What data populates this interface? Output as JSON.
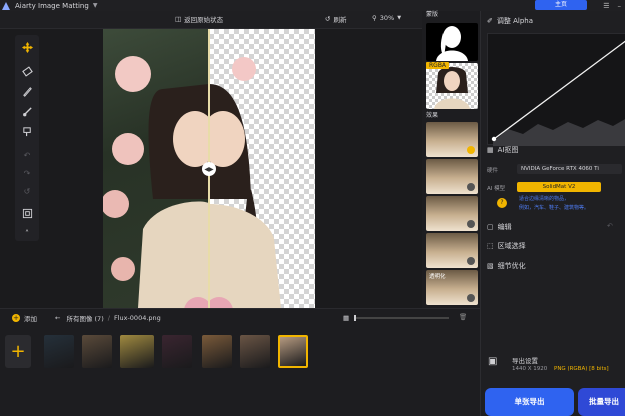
{
  "app": {
    "title": "Aiarty Image Matting",
    "home_label": "主页"
  },
  "toolbar": {
    "compare_label": "返回原始状态",
    "refresh_label": "刷新",
    "zoom_value": "30%"
  },
  "thumbs": {
    "mask_label": "蒙版",
    "rgba_label": "RGBA",
    "effects_label": "效果",
    "bottom_item_label": "透明化"
  },
  "right_panel": {
    "alpha_title": "调整 Alpha",
    "ai_matting_label": "AI抠图",
    "hardware_label": "硬件",
    "hardware_value": "NVIDIA GeForce RTX 4060 Ti",
    "model_label": "AI 模型",
    "model_value": "SolidMat V2",
    "model_desc_line1": "适合边缘清晰的物品，",
    "model_desc_line2": "例如，汽车、鞋子、建筑物等。",
    "edit_label": "编辑",
    "region_label": "区域选择",
    "refine_label": "细节优化"
  },
  "bottom": {
    "add_label": "添加",
    "folder_label": "所有图像 (7)",
    "filename": "Flux-0004.png",
    "files": [
      {
        "name": "jellyfish",
        "color": "#25303a"
      },
      {
        "name": "collage",
        "color": "#5a4a3a"
      },
      {
        "name": "bicycle",
        "color": "#a08a40"
      },
      {
        "name": "red-dress",
        "color": "#3a2530"
      },
      {
        "name": "flowers",
        "color": "#7a5a3a"
      },
      {
        "name": "portrait",
        "color": "#6a5545"
      },
      {
        "name": "portrait-selected",
        "color": "#b59a80"
      }
    ]
  },
  "export": {
    "settings_label": "导出设置",
    "resolution": "1440 X 1920",
    "format": "PNG (RGBA) [8 bits]",
    "single_label": "单张导出",
    "batch_label": "批量导出"
  },
  "colors": {
    "accent": "#f1b500",
    "primary": "#2f63f0"
  }
}
